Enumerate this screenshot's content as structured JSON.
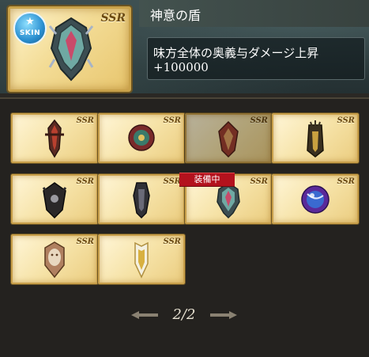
{
  "header": {
    "skin_label": "SKIN",
    "ssr_label": "SSR",
    "title": "神意の盾",
    "description_line1": "味方全体の奥義与ダメージ上昇",
    "description_line2": "+100000"
  },
  "grid": {
    "items": [
      {
        "ssr": "SSR",
        "icon": "shield-dark-red-icon",
        "color": "#7a3a2a"
      },
      {
        "ssr": "SSR",
        "icon": "shield-round-red-icon",
        "color": "#b53a3a"
      },
      {
        "ssr": "SSR",
        "icon": "shield-red-flame-icon",
        "color": "#a04030"
      },
      {
        "ssr": "SSR",
        "icon": "shield-tower-gold-icon",
        "color": "#3a3020"
      },
      {
        "ssr": "SSR",
        "icon": "shield-demon-black-icon",
        "color": "#2a2828"
      },
      {
        "ssr": "SSR",
        "icon": "shield-knight-black-icon",
        "color": "#303036"
      },
      {
        "ssr": "SSR",
        "icon": "shield-divine-silver-icon",
        "color": "#4a5a5a"
      },
      {
        "ssr": "SSR",
        "icon": "shield-orb-purple-icon",
        "color": "#5a2a9a"
      },
      {
        "ssr": "SSR",
        "icon": "shield-mask-bronze-icon",
        "color": "#b08060"
      },
      {
        "ssr": "SSR",
        "icon": "shield-gold-white-icon",
        "color": "#d8c060"
      }
    ],
    "equipped_label": "装備中"
  },
  "pager": {
    "page_text": "2/2"
  }
}
